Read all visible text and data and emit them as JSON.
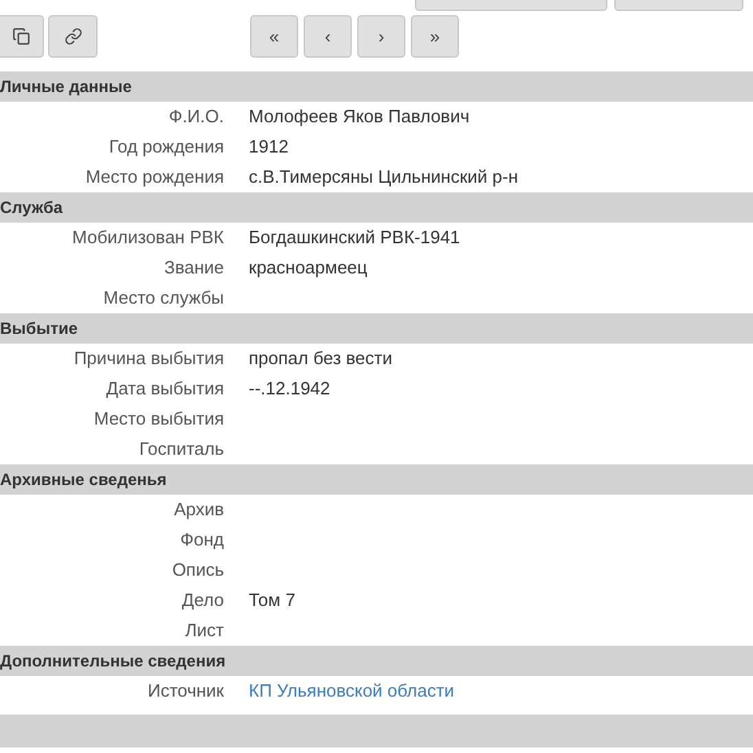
{
  "pager": [
    "«",
    "‹",
    "›",
    "»"
  ],
  "sections": [
    {
      "title": "Личные данные",
      "rows": [
        {
          "label": "Ф.И.О.",
          "value": "Молофеев Яков Павлович",
          "kind": "text"
        },
        {
          "label": "Год рождения",
          "value": "1912",
          "kind": "text"
        },
        {
          "label": "Место рождения",
          "value": "с.В.Тимерсяны Цильнинский р-н",
          "kind": "text"
        }
      ]
    },
    {
      "title": "Служба",
      "rows": [
        {
          "label": "Мобилизован РВК",
          "value": "Богдашкинский РВК-1941",
          "kind": "text"
        },
        {
          "label": "Звание",
          "value": "красноармеец",
          "kind": "text"
        },
        {
          "label": "Место службы"
        }
      ]
    },
    {
      "title": "Выбытие",
      "rows": [
        {
          "label": "Причина выбытия",
          "value": "пропал без вести",
          "kind": "text"
        },
        {
          "label": "Дата выбытия",
          "value": "--.12.1942",
          "kind": "text"
        },
        {
          "label": "Место выбытия"
        },
        {
          "label": "Госпиталь"
        }
      ]
    },
    {
      "title": "Архивные сведенья",
      "rows": [
        {
          "label": "Архив"
        },
        {
          "label": "Фонд"
        },
        {
          "label": "Опись"
        },
        {
          "label": "Дело",
          "value": "Том 7",
          "kind": "text"
        },
        {
          "label": "Лист"
        }
      ]
    },
    {
      "title": "Дополнительные сведения",
      "rows": [
        {
          "label": "Источник",
          "value": "КП Ульяновской области",
          "kind": "link"
        }
      ]
    }
  ]
}
